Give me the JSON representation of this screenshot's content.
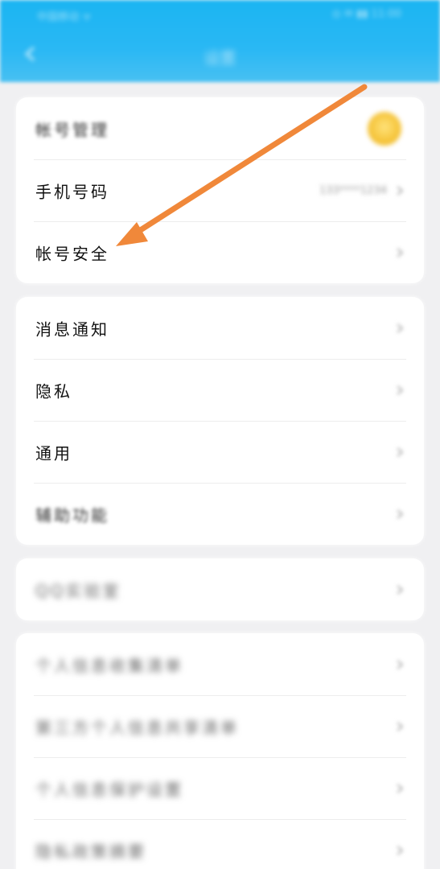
{
  "status_bar": {
    "left_text": "中国移动 ᯤ",
    "right_text": "◎ ✉ ▮▮ 11:00"
  },
  "header": {
    "title": "设置"
  },
  "colors": {
    "header_blue": "#1bb5f2",
    "arrow_orange": "#f0883a",
    "page_bg": "#f0f0f2",
    "avatar_yellow": "#f5c338"
  },
  "section_account": {
    "items": [
      {
        "label": "帐号管理"
      },
      {
        "label": "手机号码",
        "value": "133****1234"
      },
      {
        "label": "帐号安全"
      }
    ]
  },
  "section_general": {
    "items": [
      {
        "label": "消息通知"
      },
      {
        "label": "隐私"
      },
      {
        "label": "通用"
      },
      {
        "label": "辅助功能"
      }
    ]
  },
  "section_qq": {
    "items": [
      {
        "label": "QQ实验室"
      }
    ]
  },
  "section_privacy": {
    "items": [
      {
        "label": "个人信息收集清单"
      },
      {
        "label": "第三方个人信息共享清单"
      },
      {
        "label": "个人信息保护设置"
      },
      {
        "label": "隐私政策摘要"
      }
    ]
  },
  "annotation": {
    "arrow_icon": "orange-arrow-icon"
  }
}
